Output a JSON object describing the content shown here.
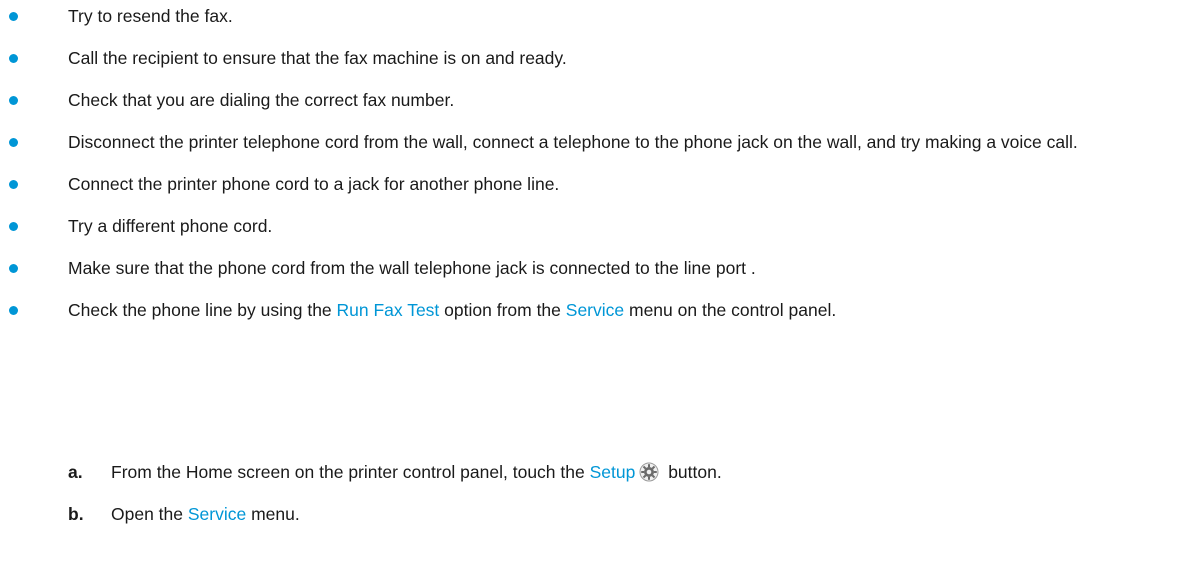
{
  "bullets": [
    {
      "text": "Try to resend the fax."
    },
    {
      "text": "Call the recipient to ensure that the fax machine is on and ready."
    },
    {
      "text": "Check that you are dialing the correct fax number."
    },
    {
      "text": "Disconnect the printer telephone cord from the wall, connect a telephone to the phone jack on the wall, and try making a voice call."
    },
    {
      "text": "Connect the printer phone cord to a jack for another phone line."
    },
    {
      "text": "Try a different phone cord."
    },
    {
      "text": "Make sure that the phone cord from the wall telephone jack is connected to the line port ."
    },
    {
      "pre": "Check the phone line by using the ",
      "link1": "Run Fax Test",
      "mid": " option from the ",
      "link2": "Service",
      "post": " menu on the control panel."
    }
  ],
  "steps": [
    {
      "marker": "a.",
      "pre": "From the Home screen on the printer control panel, touch the ",
      "link": "Setup",
      "icon": "gear-icon",
      "post": " button."
    },
    {
      "marker": "b.",
      "pre": "Open the ",
      "link": "Service",
      "post": " menu."
    }
  ],
  "colors": {
    "accent": "#0096d6",
    "text": "#1a1a1a"
  }
}
